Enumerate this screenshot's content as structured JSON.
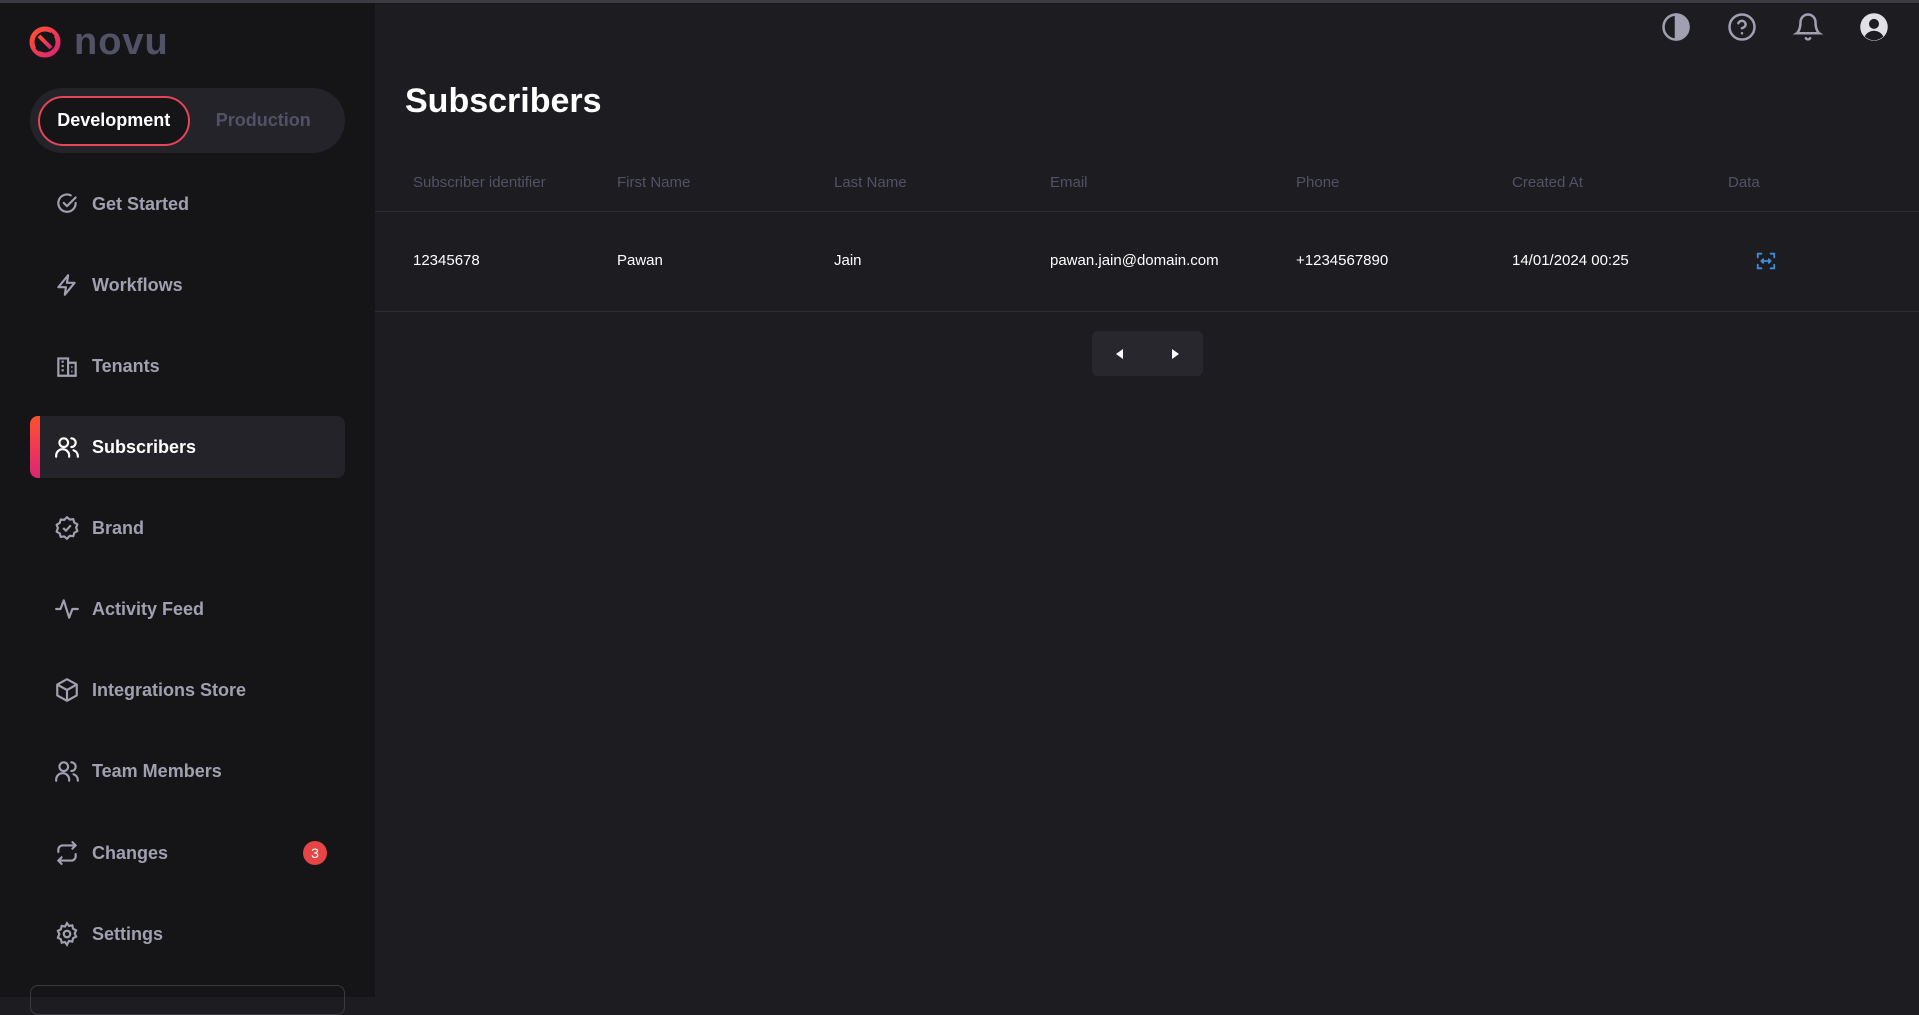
{
  "app": {
    "logo_text": "novu"
  },
  "environment": {
    "development_label": "Development",
    "production_label": "Production",
    "selected": "Development"
  },
  "sidebar": {
    "items": [
      {
        "label": "Get Started",
        "icon": "check-circle-icon"
      },
      {
        "label": "Workflows",
        "icon": "bolt-icon"
      },
      {
        "label": "Tenants",
        "icon": "building-icon"
      },
      {
        "label": "Subscribers",
        "icon": "users-icon",
        "active": true
      },
      {
        "label": "Brand",
        "icon": "badge-check-icon"
      },
      {
        "label": "Activity Feed",
        "icon": "activity-icon"
      },
      {
        "label": "Integrations Store",
        "icon": "box-icon"
      },
      {
        "label": "Team Members",
        "icon": "team-icon"
      },
      {
        "label": "Changes",
        "icon": "repeat-icon",
        "badge": "3"
      },
      {
        "label": "Settings",
        "icon": "gear-icon"
      }
    ]
  },
  "header": {
    "icons": [
      "theme-toggle-icon",
      "help-icon",
      "bell-icon",
      "avatar-icon"
    ]
  },
  "main": {
    "title": "Subscribers",
    "table": {
      "columns": [
        "Subscriber identifier",
        "First Name",
        "Last Name",
        "Email",
        "Phone",
        "Created At",
        "Data"
      ],
      "rows": [
        {
          "subscriber_id": "12345678",
          "first_name": "Pawan",
          "last_name": "Jain",
          "email": "pawan.jain@domain.com",
          "phone": "+1234567890",
          "created_at": "14/01/2024 00:25"
        }
      ]
    }
  },
  "colors": {
    "accent": "#e54556",
    "background": "#1c1c21",
    "sidebar": "#151518",
    "link": "#3d8ed8"
  }
}
